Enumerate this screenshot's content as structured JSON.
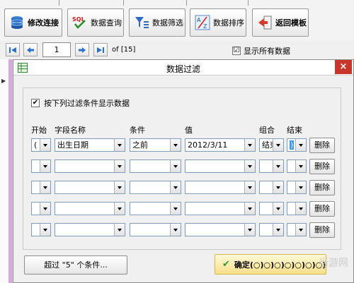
{
  "toolbar": {
    "edit_connection": "修改连接",
    "data_query": "数据查询",
    "data_filter": "数据筛选",
    "data_sort": "数据排序",
    "back_template": "返回模板",
    "sql_icon_text": "SQL"
  },
  "nav": {
    "page_value": "1",
    "page_of": "of [15]",
    "show_all_label": "显示所有数据",
    "show_all_checked": "☑"
  },
  "dialog": {
    "title": "数据过滤",
    "close": "×",
    "filter_checkbox_label": "按下列过滤条件显示数据",
    "filter_checked": "✔",
    "columns": {
      "start": "开始",
      "field": "字段名称",
      "condition": "条件",
      "value": "值",
      "combine": "组合",
      "end": "结束"
    },
    "rows": [
      {
        "start": "(",
        "field": "出生日期",
        "condition": "之前",
        "value": "2012/3/11",
        "combine": "结束",
        "end": ")",
        "delete": "删除"
      },
      {
        "start": "",
        "field": "",
        "condition": "",
        "value": "",
        "combine": "",
        "end": "",
        "delete": "删除"
      },
      {
        "start": "",
        "field": "",
        "condition": "",
        "value": "",
        "combine": "",
        "end": "",
        "delete": "删除"
      },
      {
        "start": "",
        "field": "",
        "condition": "",
        "value": "",
        "combine": "",
        "end": "",
        "delete": "删除"
      },
      {
        "start": "",
        "field": "",
        "condition": "",
        "value": "",
        "combine": "",
        "end": "",
        "delete": "删除"
      }
    ],
    "exceed_button": "超过 \"5\" 个条件...",
    "ok_button": "确定(○)○)○)○)○)○)○)○)",
    "ok_icon": "✔"
  },
  "watermark": "当游网"
}
